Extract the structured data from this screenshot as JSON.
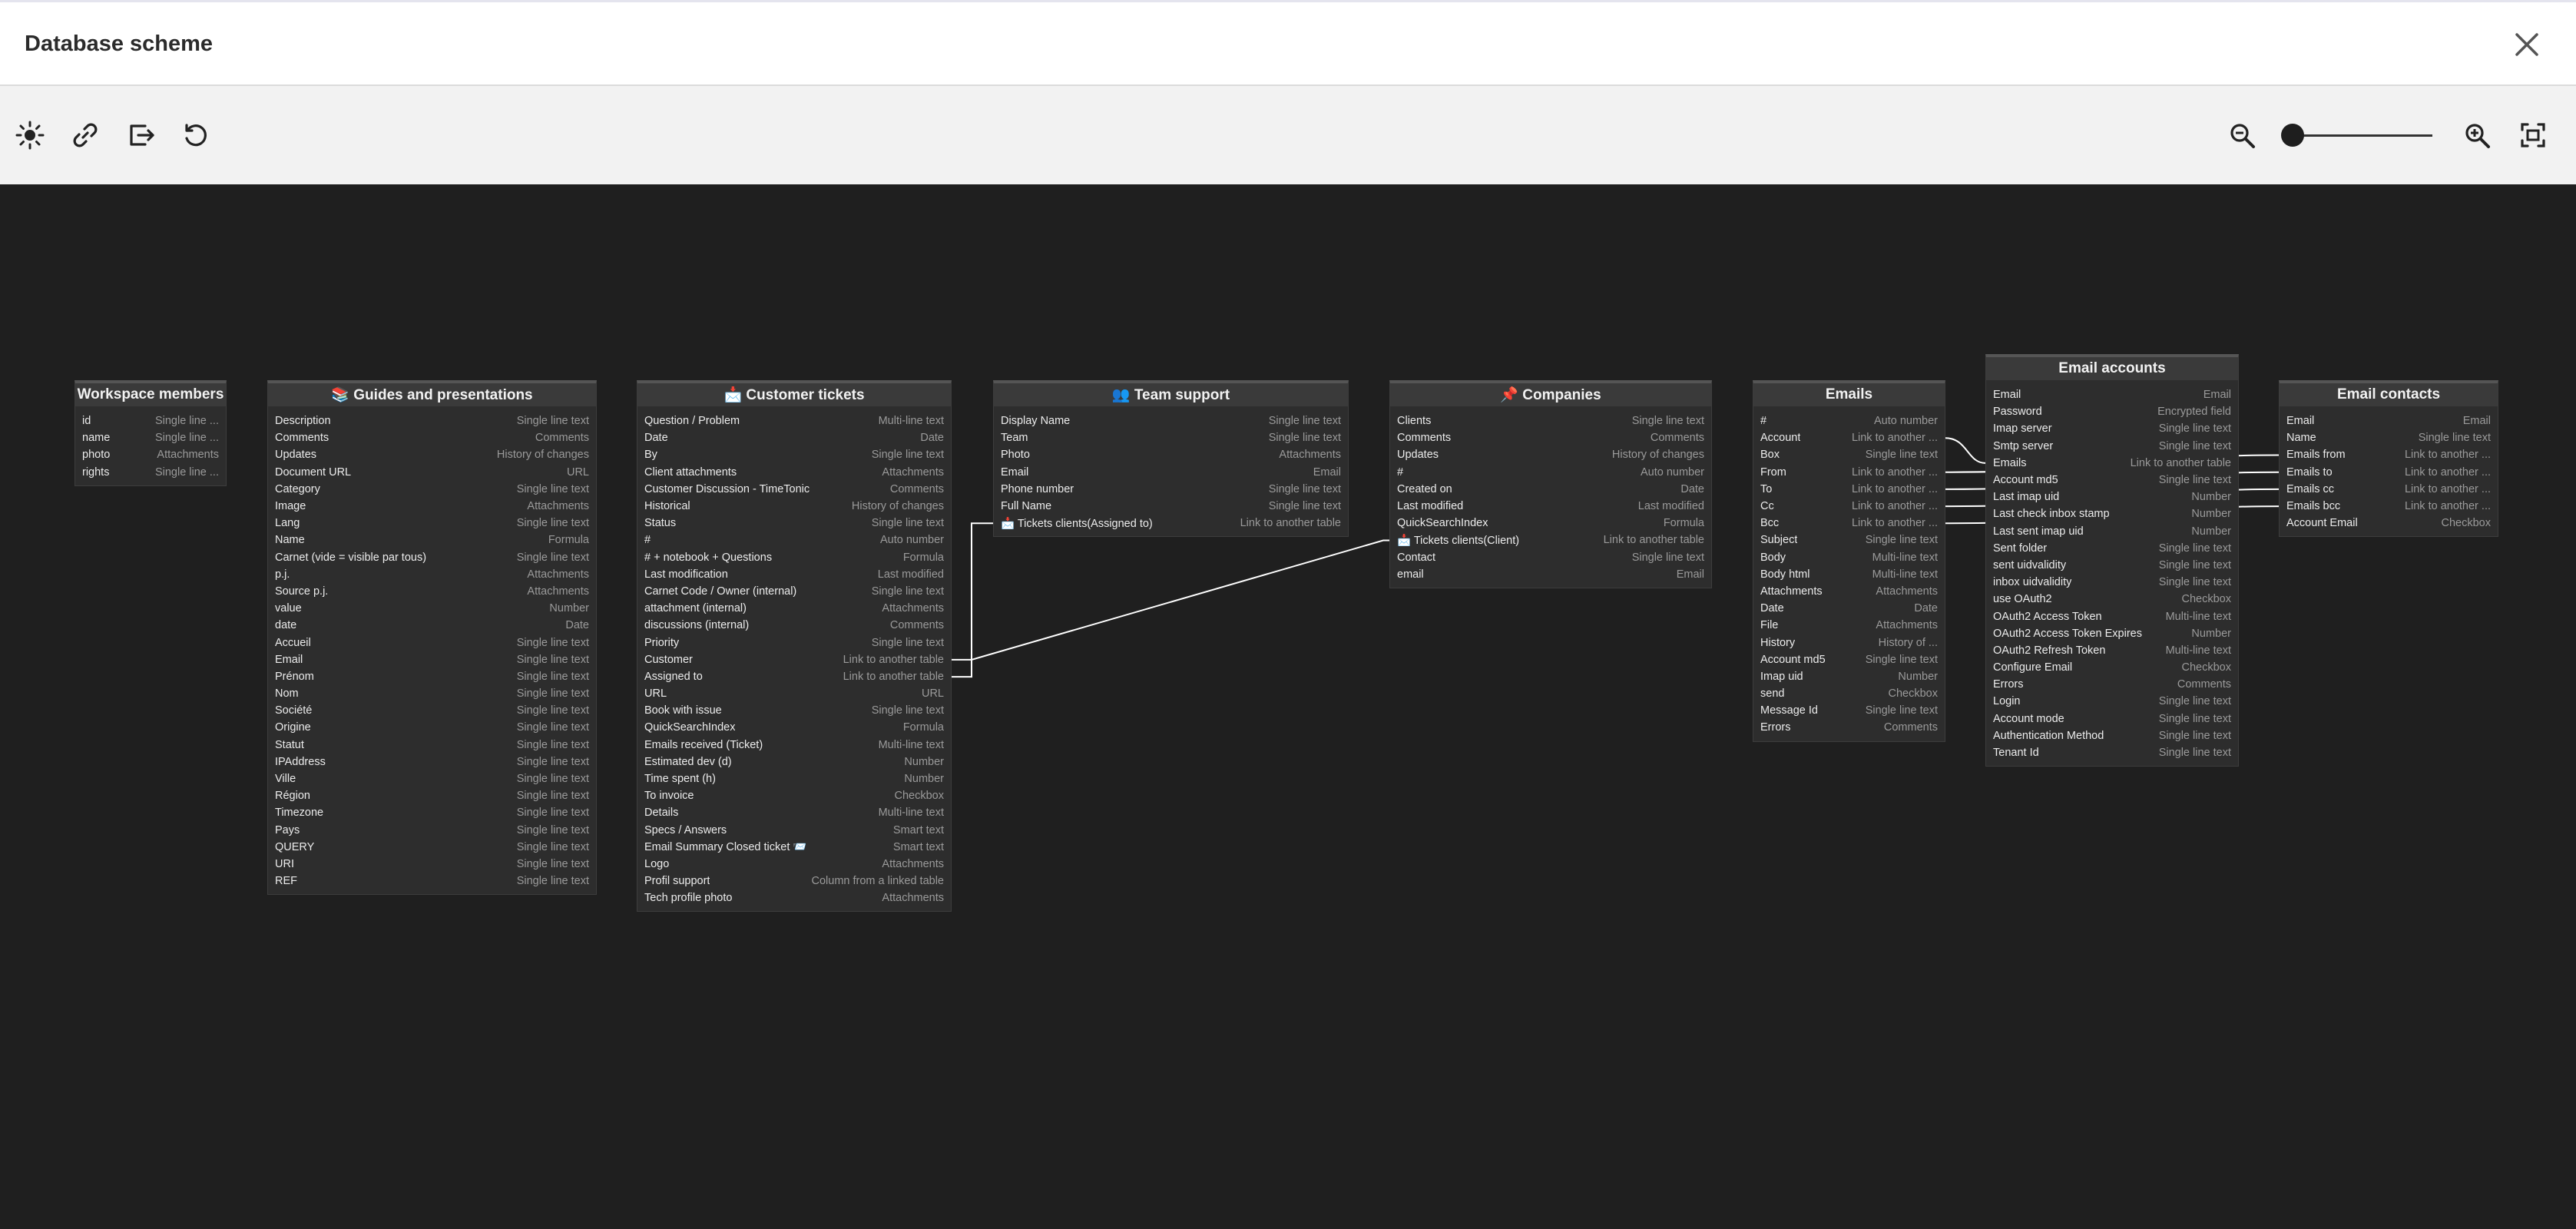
{
  "header": {
    "title": "Database scheme"
  },
  "toolbar": {
    "left_icons": [
      "sun-icon",
      "link-icon",
      "export-icon",
      "refresh-icon"
    ],
    "zoom": {
      "level": 0.0
    }
  },
  "tables": [
    {
      "id": "workspace-members",
      "title": "Workspace members",
      "fields": [
        [
          "id",
          "Single line ..."
        ],
        [
          "name",
          "Single line ..."
        ],
        [
          "photo",
          "Attachments"
        ],
        [
          "rights",
          "Single line ..."
        ]
      ]
    },
    {
      "id": "guides",
      "title": "📚 Guides and presentations",
      "fields": [
        [
          "Description",
          "Single line text"
        ],
        [
          "Comments",
          "Comments"
        ],
        [
          "Updates",
          "History of changes"
        ],
        [
          "Document URL",
          "URL"
        ],
        [
          "Category",
          "Single line text"
        ],
        [
          "Image",
          "Attachments"
        ],
        [
          "Lang",
          "Single line text"
        ],
        [
          "Name",
          "Formula"
        ],
        [
          "Carnet (vide = visible par tous)",
          "Single line text"
        ],
        [
          "p.j.",
          "Attachments"
        ],
        [
          "Source p.j.",
          "Attachments"
        ],
        [
          "value",
          "Number"
        ],
        [
          "date",
          "Date"
        ],
        [
          "Accueil",
          "Single line text"
        ],
        [
          "Email",
          "Single line text"
        ],
        [
          "Prénom",
          "Single line text"
        ],
        [
          "Nom",
          "Single line text"
        ],
        [
          "Société",
          "Single line text"
        ],
        [
          "Origine",
          "Single line text"
        ],
        [
          "Statut",
          "Single line text"
        ],
        [
          "IPAddress",
          "Single line text"
        ],
        [
          "Ville",
          "Single line text"
        ],
        [
          "Région",
          "Single line text"
        ],
        [
          "Timezone",
          "Single line text"
        ],
        [
          "Pays",
          "Single line text"
        ],
        [
          "QUERY",
          "Single line text"
        ],
        [
          "URI",
          "Single line text"
        ],
        [
          "REF",
          "Single line text"
        ]
      ]
    },
    {
      "id": "customer-tickets",
      "title": "📩 Customer tickets",
      "fields": [
        [
          "Question / Problem",
          "Multi-line text"
        ],
        [
          "Date",
          "Date"
        ],
        [
          "By",
          "Single line text"
        ],
        [
          "Client attachments",
          "Attachments"
        ],
        [
          "Customer Discussion - TimeTonic",
          "Comments"
        ],
        [
          "Historical",
          "History of changes"
        ],
        [
          "Status",
          "Single line text"
        ],
        [
          "#",
          "Auto number"
        ],
        [
          "# + notebook + Questions",
          "Formula"
        ],
        [
          "Last modification",
          "Last modified"
        ],
        [
          "Carnet Code / Owner (internal)",
          "Single line text"
        ],
        [
          "attachment (internal)",
          "Attachments"
        ],
        [
          "discussions (internal)",
          "Comments"
        ],
        [
          "Priority",
          "Single line text"
        ],
        [
          "Customer",
          "Link to another table"
        ],
        [
          "Assigned to",
          "Link to another table"
        ],
        [
          "URL",
          "URL"
        ],
        [
          "Book with issue",
          "Single line text"
        ],
        [
          "QuickSearchIndex",
          "Formula"
        ],
        [
          "Emails received (Ticket)",
          "Multi-line text"
        ],
        [
          "Estimated dev (d)",
          "Number"
        ],
        [
          "Time spent (h)",
          "Number"
        ],
        [
          "To invoice",
          "Checkbox"
        ],
        [
          "Details",
          "Multi-line text"
        ],
        [
          "Specs / Answers",
          "Smart text"
        ],
        [
          "Email Summary Closed ticket 📨",
          "Smart text"
        ],
        [
          "Logo",
          "Attachments"
        ],
        [
          "Profil support",
          "Column from a linked table"
        ],
        [
          "Tech profile photo",
          "Attachments"
        ]
      ]
    },
    {
      "id": "team-support",
      "title": "👥 Team support",
      "fields": [
        [
          "Display Name",
          "Single line text"
        ],
        [
          "Team",
          "Single line text"
        ],
        [
          "Photo",
          "Attachments"
        ],
        [
          "Email",
          "Email"
        ],
        [
          "Phone number",
          "Single line text"
        ],
        [
          "Full Name",
          "Single line text"
        ],
        [
          "📩 Tickets clients(Assigned to)",
          "Link to another table"
        ]
      ]
    },
    {
      "id": "companies",
      "title": "📌 Companies",
      "fields": [
        [
          "Clients",
          "Single line text"
        ],
        [
          "Comments",
          "Comments"
        ],
        [
          "Updates",
          "History of changes"
        ],
        [
          "#",
          "Auto number"
        ],
        [
          "Created on",
          "Date"
        ],
        [
          "Last modified",
          "Last modified"
        ],
        [
          "QuickSearchIndex",
          "Formula"
        ],
        [
          "📩 Tickets clients(Client)",
          "Link to another table"
        ],
        [
          "Contact",
          "Single line text"
        ],
        [
          "email",
          "Email"
        ]
      ]
    },
    {
      "id": "emails",
      "title": "Emails",
      "fields": [
        [
          "#",
          "Auto number"
        ],
        [
          "Account",
          "Link to another ..."
        ],
        [
          "Box",
          "Single line text"
        ],
        [
          "From",
          "Link to another ..."
        ],
        [
          "To",
          "Link to another ..."
        ],
        [
          "Cc",
          "Link to another ..."
        ],
        [
          "Bcc",
          "Link to another ..."
        ],
        [
          "Subject",
          "Single line text"
        ],
        [
          "Body",
          "Multi-line text"
        ],
        [
          "Body html",
          "Multi-line text"
        ],
        [
          "Attachments",
          "Attachments"
        ],
        [
          "Date",
          "Date"
        ],
        [
          "File",
          "Attachments"
        ],
        [
          "History",
          "History of ..."
        ],
        [
          "Account md5",
          "Single line text"
        ],
        [
          "Imap uid",
          "Number"
        ],
        [
          "send",
          "Checkbox"
        ],
        [
          "Message Id",
          "Single line text"
        ],
        [
          "Errors",
          "Comments"
        ]
      ]
    },
    {
      "id": "email-accounts",
      "title": "Email accounts",
      "fields": [
        [
          "Email",
          "Email"
        ],
        [
          "Password",
          "Encrypted field"
        ],
        [
          "Imap server",
          "Single line text"
        ],
        [
          "Smtp server",
          "Single line text"
        ],
        [
          "Emails",
          "Link to another table"
        ],
        [
          "Account md5",
          "Single line text"
        ],
        [
          "Last imap uid",
          "Number"
        ],
        [
          "Last check inbox stamp",
          "Number"
        ],
        [
          "Last sent imap uid",
          "Number"
        ],
        [
          "Sent folder",
          "Single line text"
        ],
        [
          "sent uidvalidity",
          "Single line text"
        ],
        [
          "inbox uidvalidity",
          "Single line text"
        ],
        [
          "use OAuth2",
          "Checkbox"
        ],
        [
          "OAuth2 Access Token",
          "Multi-line text"
        ],
        [
          "OAuth2 Access Token Expires",
          "Number"
        ],
        [
          "OAuth2 Refresh Token",
          "Multi-line text"
        ],
        [
          "Configure Email",
          "Checkbox"
        ],
        [
          "Errors",
          "Comments"
        ],
        [
          "Login",
          "Single line text"
        ],
        [
          "Account mode",
          "Single line text"
        ],
        [
          "Authentication Method",
          "Single line text"
        ],
        [
          "Tenant Id",
          "Single line text"
        ]
      ]
    },
    {
      "id": "email-contacts",
      "title": "Email contacts",
      "fields": [
        [
          "Email",
          "Email"
        ],
        [
          "Name",
          "Single line text"
        ],
        [
          "Emails from",
          "Link to another ..."
        ],
        [
          "Emails to",
          "Link to another ..."
        ],
        [
          "Emails cc",
          "Link to another ..."
        ],
        [
          "Emails bcc",
          "Link to another ..."
        ],
        [
          "Account Email",
          "Checkbox"
        ]
      ]
    }
  ],
  "relations": [
    {
      "from": "team-support.📩 Tickets clients(Assigned to)",
      "to": "customer-tickets.Assigned to"
    },
    {
      "from": "companies.📩 Tickets clients(Client)",
      "to": "customer-tickets.Customer"
    },
    {
      "from": "emails.Account",
      "to": "email-accounts.Emails"
    },
    {
      "from": "emails.From",
      "to": "email-contacts.Emails from"
    },
    {
      "from": "emails.To",
      "to": "email-contacts.Emails to"
    },
    {
      "from": "emails.Cc",
      "to": "email-contacts.Emails cc"
    },
    {
      "from": "emails.Bcc",
      "to": "email-contacts.Emails bcc"
    }
  ]
}
